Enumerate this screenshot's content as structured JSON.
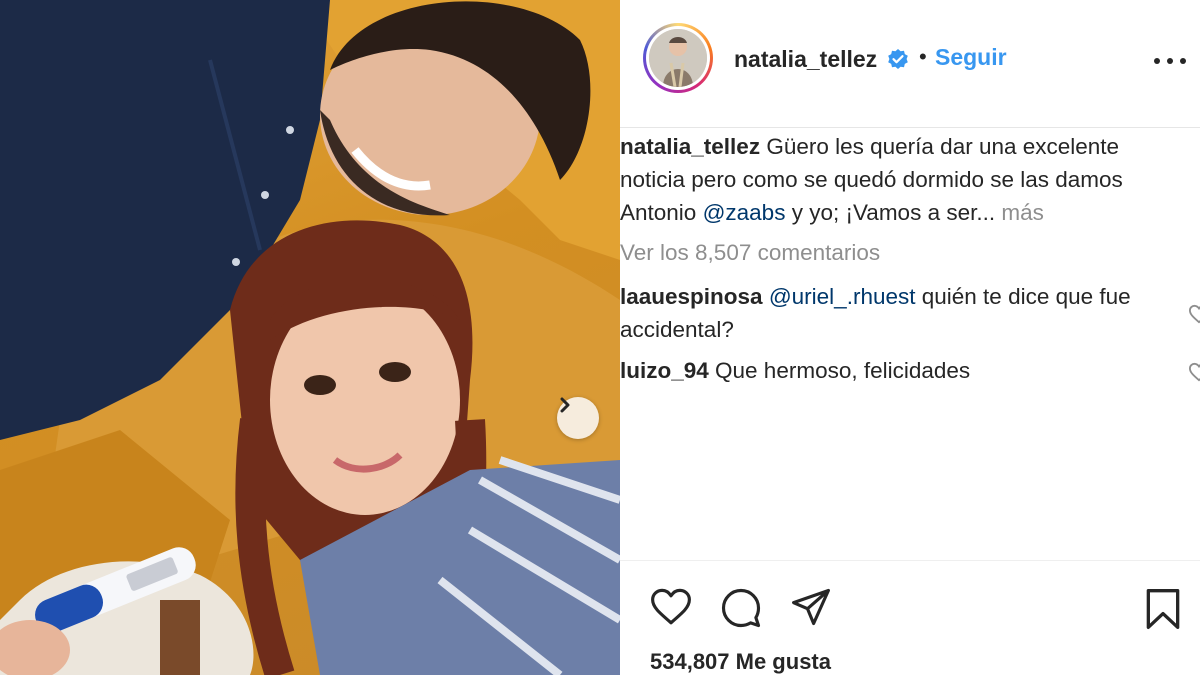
{
  "post": {
    "username": "natalia_tellez",
    "separator": "•",
    "follow_label": "Seguir",
    "caption": {
      "username": "natalia_tellez",
      "text_1": " Güero les quería dar una excelente noticia pero como se quedó dormido se las damos Antonio ",
      "mention": "@zaabs",
      "text_2": " y yo; ¡Vamos a ser... ",
      "more_label": "más"
    },
    "view_all_comments": "Ver los 8,507 comentarios",
    "comments": [
      {
        "username": "laauespinosa",
        "mention": "@uriel_.rhuest",
        "text": " quién te dice que fue accidental?"
      },
      {
        "username": "luizo_94",
        "text": " Que hermoso, felicidades"
      }
    ],
    "likes_label": "534,807 Me gusta"
  },
  "icons": {
    "verified": "verified-badge-icon",
    "more": "more-options-icon",
    "like": "heart-icon",
    "comment": "comment-icon",
    "share": "paper-plane-icon",
    "save": "bookmark-icon",
    "next": "chevron-right-icon"
  },
  "colors": {
    "link": "#3897f0",
    "mention": "#00376b",
    "muted": "#8e8e8e",
    "text": "#262626"
  }
}
